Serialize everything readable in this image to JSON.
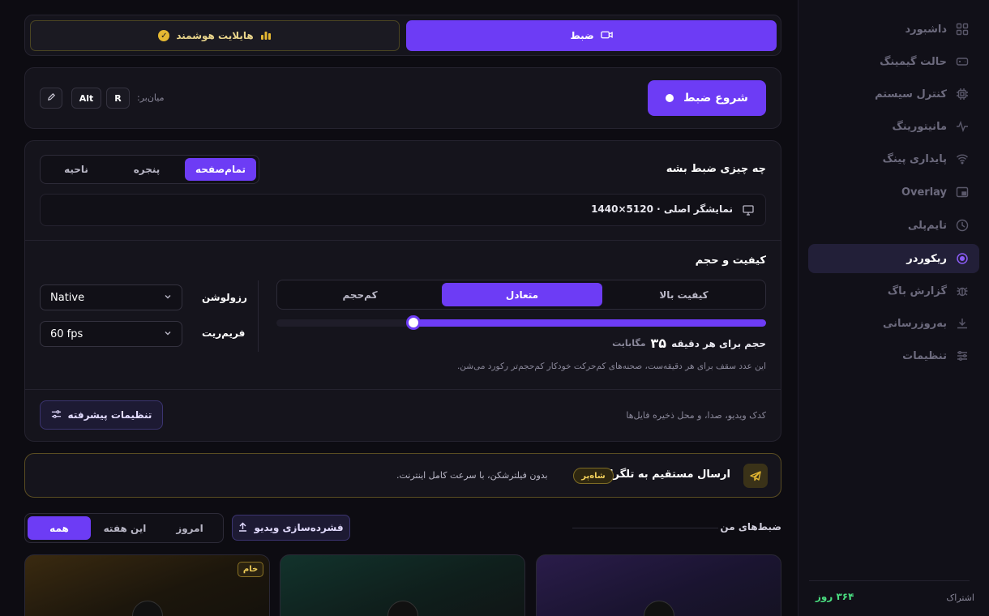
{
  "sidebar": {
    "items": [
      {
        "label": "داشبورد",
        "icon": "grid-icon"
      },
      {
        "label": "حالت گیمینگ",
        "icon": "gamepad-icon"
      },
      {
        "label": "کنترل سیستم",
        "icon": "cpu-icon"
      },
      {
        "label": "مانیتورینگ",
        "icon": "pulse-icon"
      },
      {
        "label": "پایداری پینگ",
        "icon": "wifi-icon"
      },
      {
        "label": "Overlay",
        "icon": "overlay-icon"
      },
      {
        "label": "تایم‌پلی",
        "icon": "clock-icon"
      },
      {
        "label": "ریکوردر",
        "icon": "record-icon",
        "active": true
      },
      {
        "label": "گزارش باگ",
        "icon": "bug-icon"
      },
      {
        "label": "به‌روزرسانی",
        "icon": "download-icon"
      },
      {
        "label": "تنظیمات",
        "icon": "sliders-icon"
      }
    ],
    "subscription": {
      "label": "اشتراک",
      "value": "۳۶۴ روز"
    }
  },
  "mode": {
    "record": "ضبط",
    "highlight": "هایلایت هوشمند"
  },
  "start": {
    "button": "شروع ضبط",
    "shortcut_label": "میان‌بر:",
    "key1": "Alt",
    "key2": "R"
  },
  "capture": {
    "title": "چه چیزی ضبط بشه",
    "tabs": [
      "تمام‌صفحه",
      "پنجره",
      "ناحیه"
    ],
    "active_tab": 0,
    "display": "نمایشگر اصلی · 5120×1440"
  },
  "quality": {
    "title": "کیفیت و حجم",
    "presets": [
      "کیفیت بالا",
      "متعادل",
      "کم‌حجم"
    ],
    "active_preset": 1,
    "slider_fraction": 0.28,
    "size_label": "حجم برای هر دقیقه",
    "size_value": "۳۵",
    "size_unit": "مگابایت",
    "hint": "این عدد سقف برای هر دقیقه‌ست، صحنه‌های کم‌حرکت خودکار کم‌حجم‌تر رکورد می‌شن.",
    "resolution_label": "رزولوشن",
    "resolution_value": "Native",
    "framerate_label": "فریم‌ریت",
    "framerate_value": "60 fps",
    "advanced_hint": "کدک ویدیو، صدا، و محل ذخیره فایل‌ها",
    "advanced_button": "تنظیمات پیشرفته"
  },
  "telegram": {
    "title": "ارسال مستقیم به تلگرام",
    "badge": "شاه‌پر",
    "desc": "بدون فیلترشکن، با سرعت کامل اینترنت."
  },
  "recordings": {
    "title": "ضبط‌های من",
    "compress_button": "فشرده‌سازی ویدیو",
    "filters": [
      "امروز",
      "این هفته",
      "همه"
    ],
    "active_filter": 2,
    "raw_badge": "خام"
  }
}
